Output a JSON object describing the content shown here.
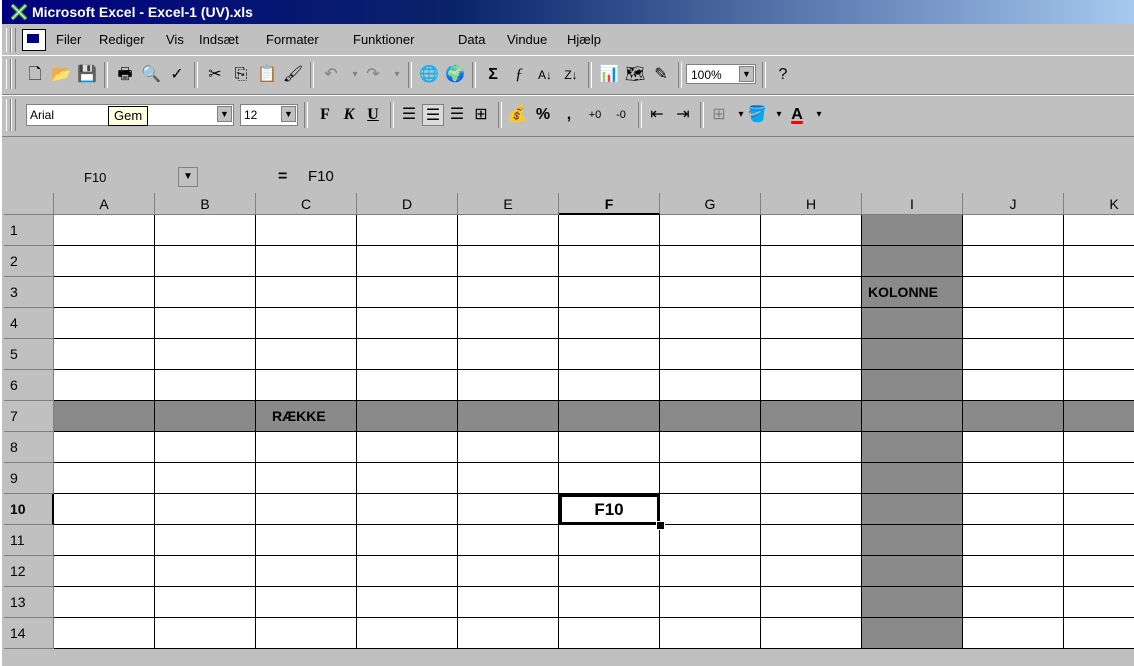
{
  "window": {
    "title": "Microsoft Excel - Excel-1 (UV).xls"
  },
  "menu": [
    "Filer",
    "Rediger",
    "Vis",
    "Indsæt",
    "Formater",
    "Funktioner",
    "Data",
    "Vindue",
    "Hjælp"
  ],
  "standard_toolbar": {
    "zoom": "100%"
  },
  "formatting_toolbar": {
    "font": "Arial",
    "tooltip": "Gem",
    "size": "12",
    "bold": "F",
    "italic": "K",
    "underline": "U",
    "percent": "%",
    "comma": ","
  },
  "formula_bar": {
    "name_box": "F10",
    "equals": "=",
    "content": "F10"
  },
  "sheet": {
    "columns": [
      "A",
      "B",
      "C",
      "D",
      "E",
      "F",
      "G",
      "H",
      "I",
      "J",
      "K"
    ],
    "rows": [
      "1",
      "2",
      "3",
      "4",
      "5",
      "6",
      "7",
      "8",
      "9",
      "10",
      "11",
      "12",
      "13",
      "14"
    ],
    "highlight_column": "I",
    "highlight_row": "7",
    "active_cell": "F10",
    "cells": {
      "I3": "KOLONNE",
      "C7": "RÆKKE",
      "F10": "F10"
    }
  },
  "colors": {
    "title_bar": "#000080",
    "highlight": "#8a8a8a",
    "chrome": "#c0c0c0"
  }
}
